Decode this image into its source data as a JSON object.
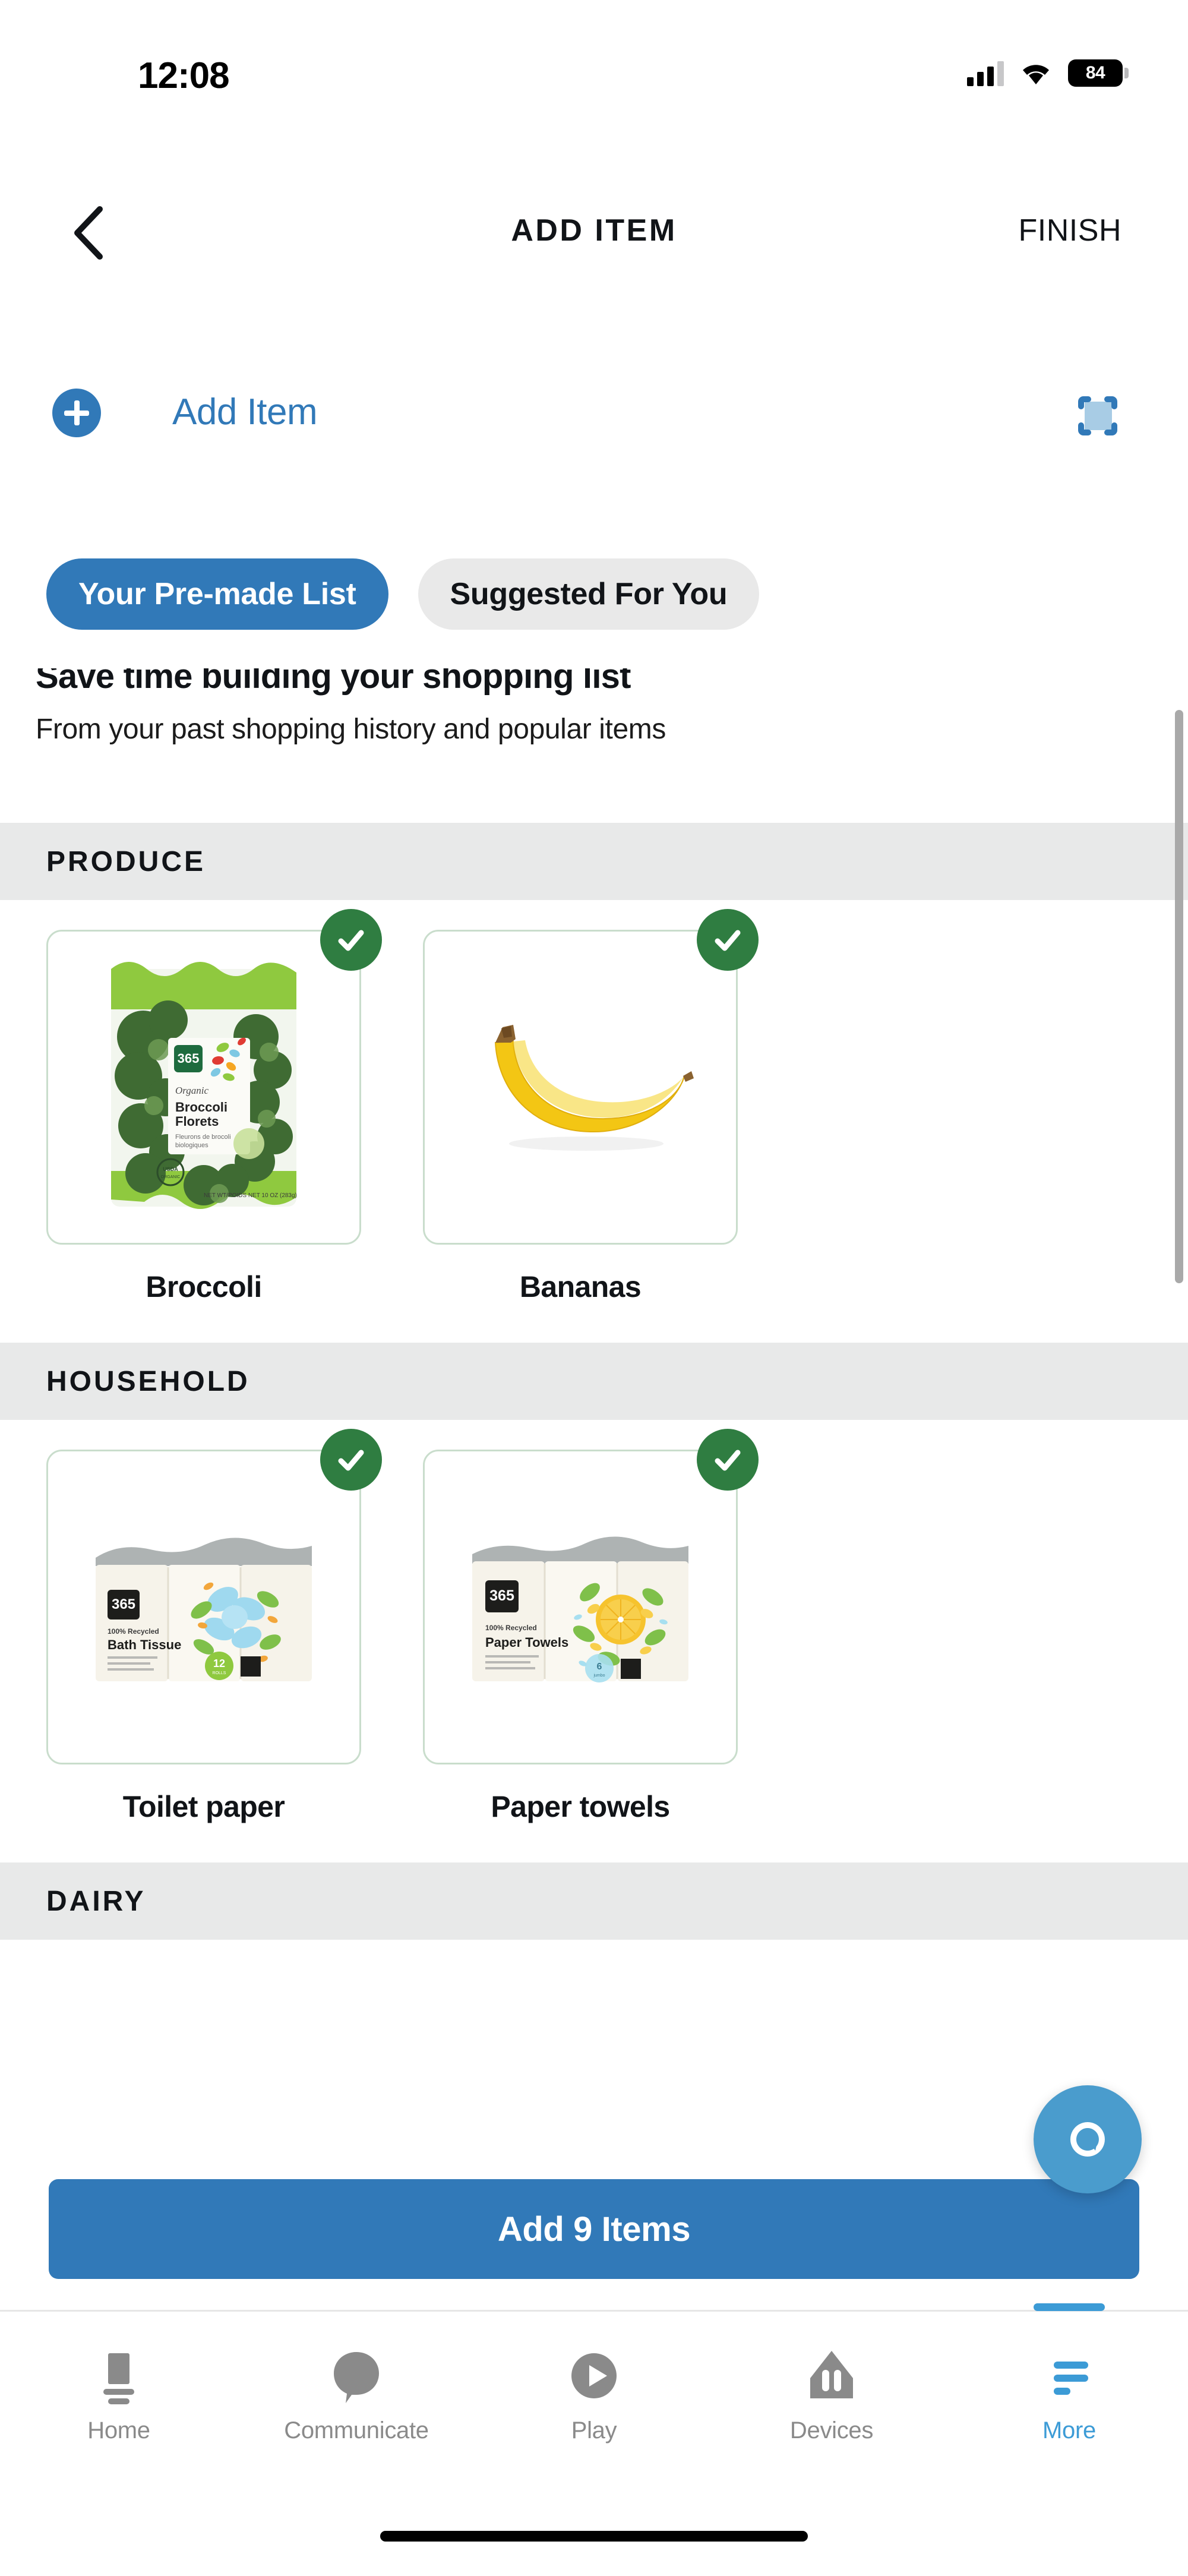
{
  "status_bar": {
    "time": "12:08",
    "battery_level": "84",
    "icons": [
      "cellular-signal-icon",
      "wifi-icon",
      "battery-icon"
    ]
  },
  "nav": {
    "back_icon": "chevron-left-icon",
    "title": "ADD ITEM",
    "finish_label": "FINISH"
  },
  "add_item": {
    "plus_icon": "plus-circle-icon",
    "placeholder": "Add Item",
    "value": "",
    "scan_icon": "barcode-scan-icon"
  },
  "tabs": [
    {
      "label": "Your Pre-made List",
      "active": true
    },
    {
      "label": "Suggested For You",
      "active": false
    }
  ],
  "promo": {
    "title": "Save time building your shopping list",
    "subtitle": "From your past shopping history and popular items"
  },
  "sections": [
    {
      "name": "PRODUCE",
      "items": [
        {
          "label": "Broccoli",
          "selected": true,
          "image": "broccoli-florets-bag-image"
        },
        {
          "label": "Bananas",
          "selected": true,
          "image": "banana-image"
        }
      ]
    },
    {
      "name": "HOUSEHOLD",
      "items": [
        {
          "label": "Toilet paper",
          "selected": true,
          "image": "bath-tissue-pack-image"
        },
        {
          "label": "Paper towels",
          "selected": true,
          "image": "paper-towels-pack-image"
        }
      ]
    },
    {
      "name": "DAIRY",
      "items": []
    }
  ],
  "footer": {
    "add_button_label": "Add 9 Items",
    "assistant_fab_icon": "assistant-circle-icon"
  },
  "tabbar": [
    {
      "label": "Home",
      "icon": "tv-icon",
      "active": false
    },
    {
      "label": "Communicate",
      "icon": "speech-bubble-icon",
      "active": false
    },
    {
      "label": "Play",
      "icon": "play-circle-icon",
      "active": false
    },
    {
      "label": "Devices",
      "icon": "devices-icon",
      "active": false
    },
    {
      "label": "More",
      "icon": "hamburger-menu-icon",
      "active": true
    }
  ],
  "colors": {
    "accent_blue": "#3179b8",
    "fab_blue": "#4a9ccd",
    "check_green": "#2f7d41",
    "card_border_green": "#c9ddcc",
    "section_gray": "#e8e9e9",
    "tab_inactive_gray": "#e9e9e9",
    "tabbar_active_blue": "#3c9bd6"
  }
}
